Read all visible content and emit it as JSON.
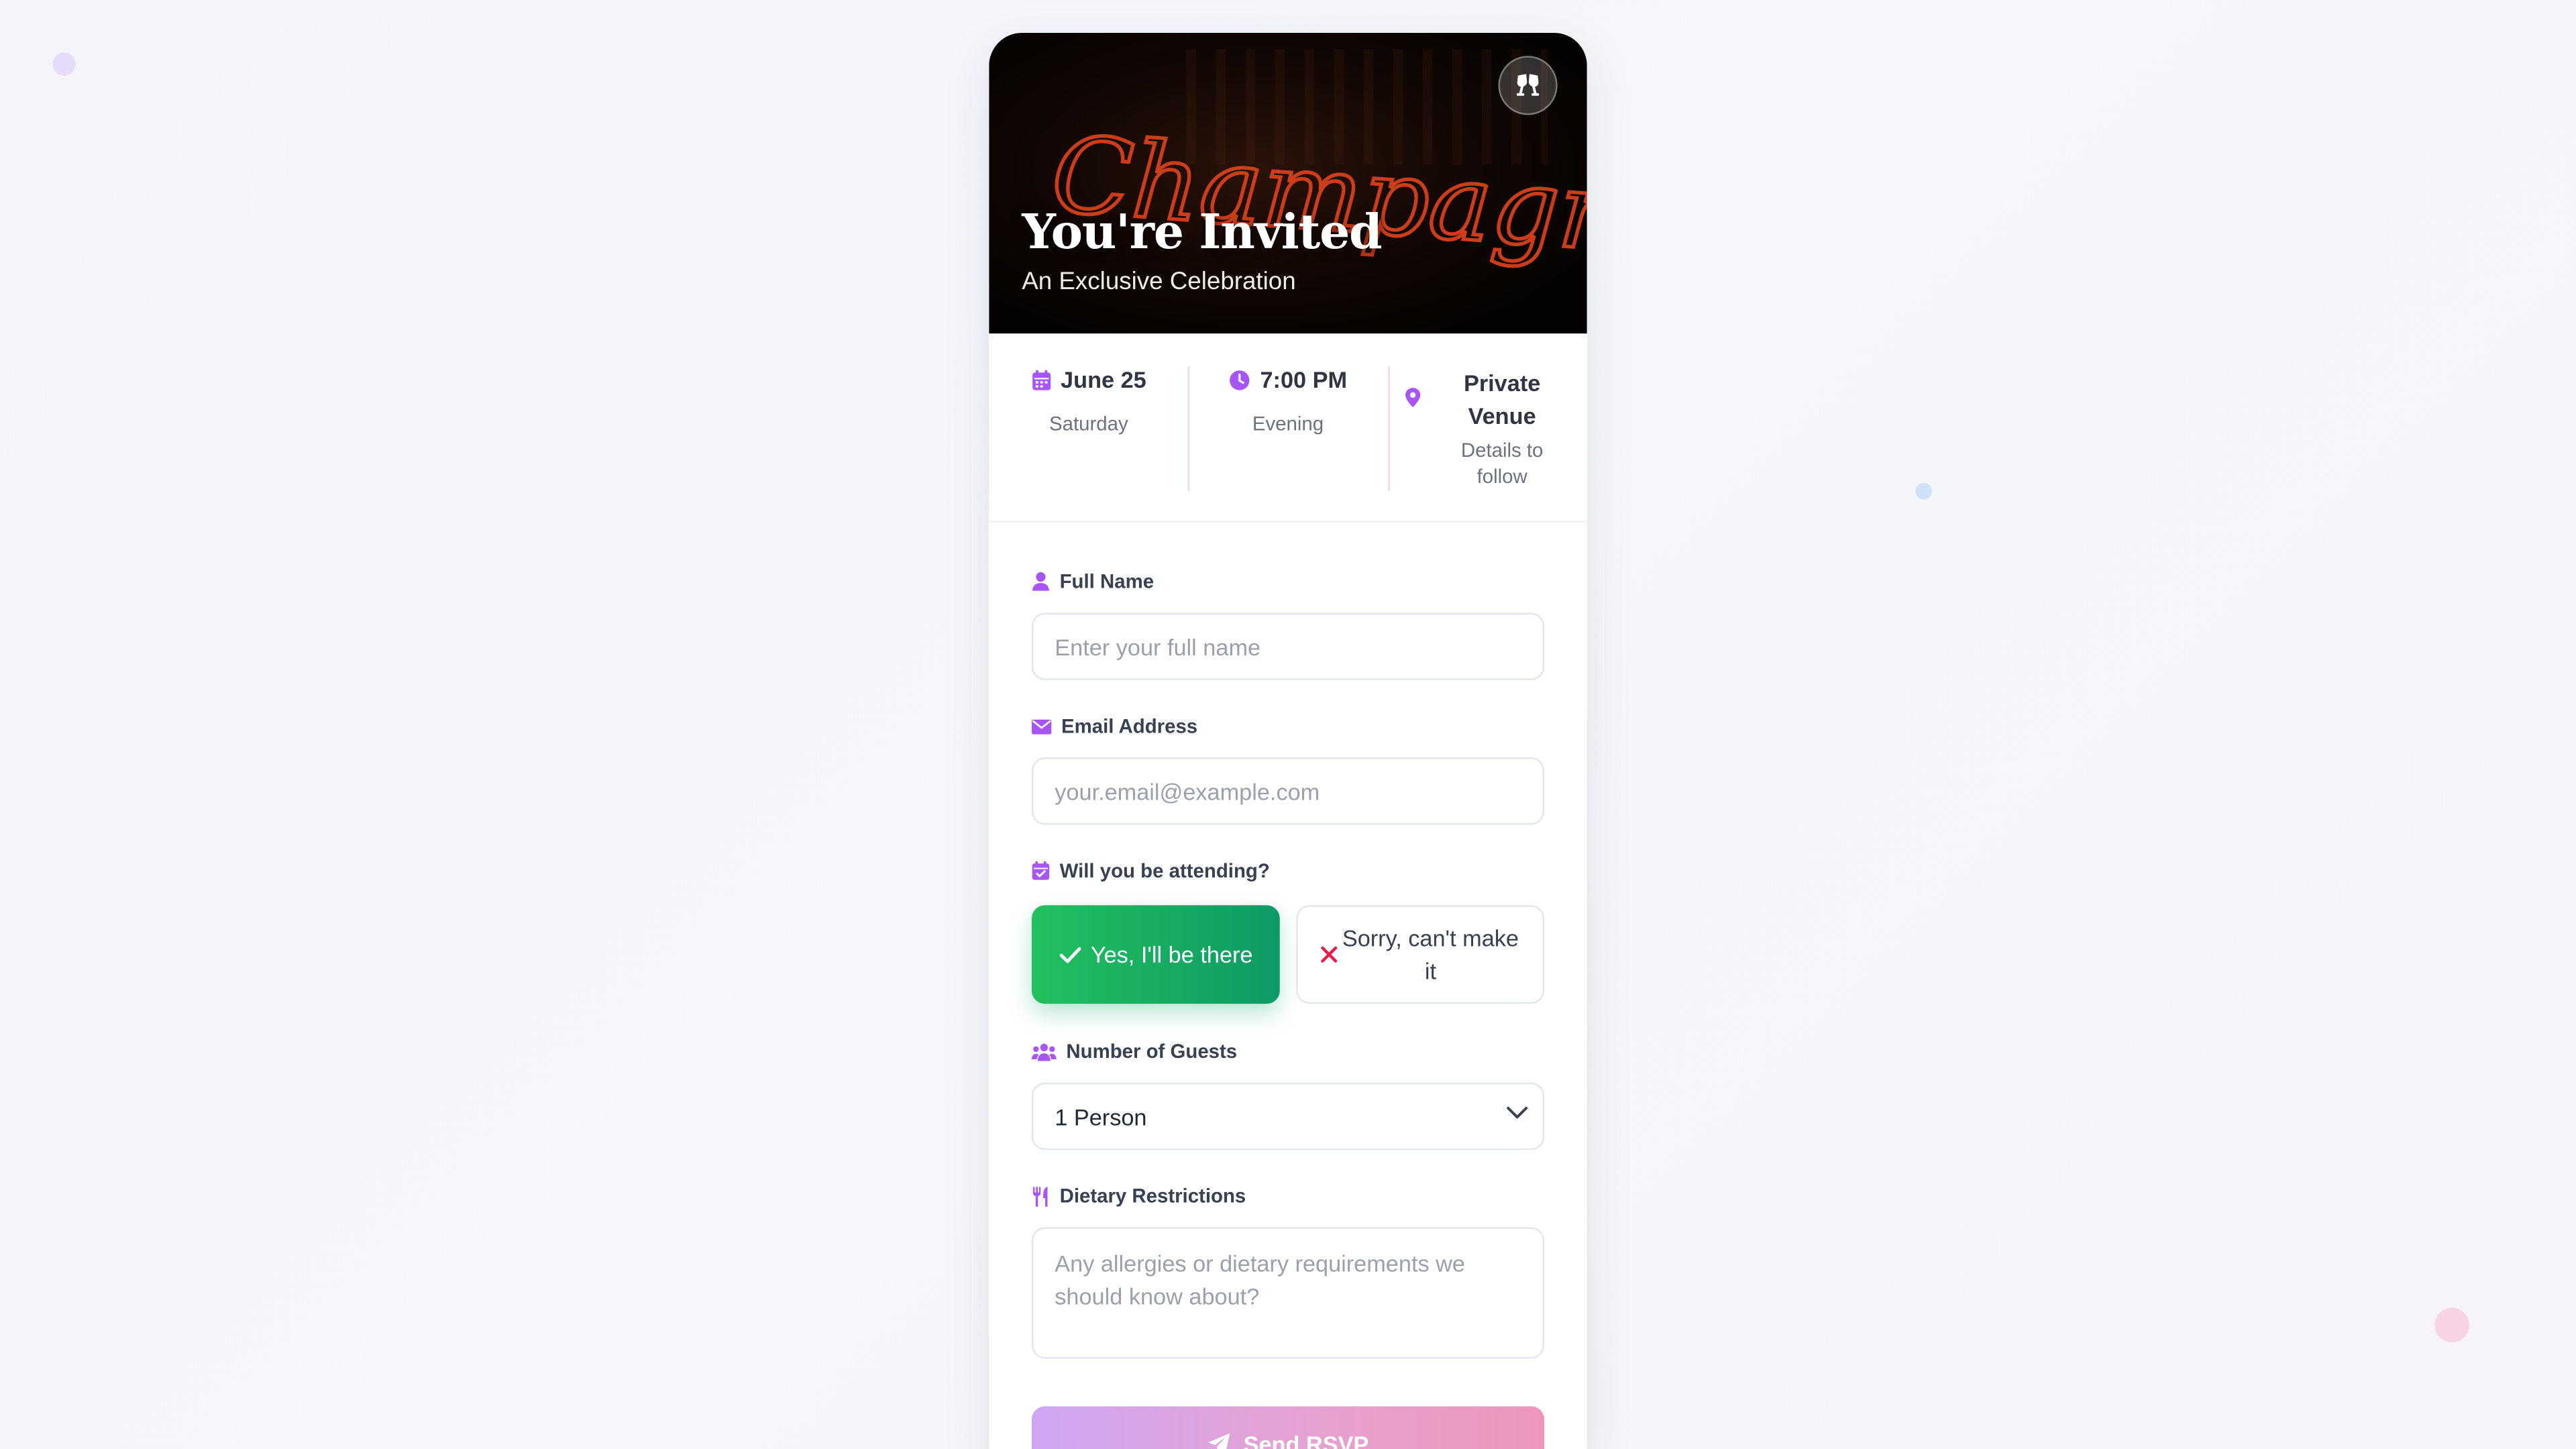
{
  "hero": {
    "title": "You're Invited",
    "subtitle": "An Exclusive Celebration",
    "neon_sign": "Champagne",
    "badge_icon": "cheers-icon"
  },
  "details": {
    "date": {
      "label": "June 25",
      "sub": "Saturday",
      "icon": "calendar-icon"
    },
    "time": {
      "label": "7:00 PM",
      "sub": "Evening",
      "icon": "clock-icon"
    },
    "venue": {
      "label": "Private Venue",
      "sub": "Details to follow",
      "icon": "map-pin-icon"
    }
  },
  "form": {
    "name": {
      "label": "Full Name",
      "placeholder": "Enter your full name",
      "value": "",
      "icon": "user-icon"
    },
    "email": {
      "label": "Email Address",
      "placeholder": "your.email@example.com",
      "value": "",
      "icon": "envelope-icon"
    },
    "attending": {
      "label": "Will you be attending?",
      "icon": "calendar-check-icon",
      "yes_label": "Yes, I'll be there",
      "no_label": "Sorry, can't make it",
      "selected": "yes"
    },
    "guests": {
      "label": "Number of Guests",
      "selected": "1 Person",
      "icon": "users-icon"
    },
    "dietary": {
      "label": "Dietary Restrictions",
      "placeholder": "Any allergies or dietary requirements we should know about?",
      "value": "",
      "icon": "utensils-icon"
    },
    "submit_label": "Send RSVP",
    "submit_icon": "paper-plane-icon"
  },
  "colors": {
    "accent": "#a855f7",
    "yes_gradient_start": "#22c05e",
    "yes_gradient_end": "#0e9a66",
    "decline": "#e11d48",
    "submit_gradient_start": "#cfa6f4",
    "submit_gradient_end": "#ee96ba"
  }
}
